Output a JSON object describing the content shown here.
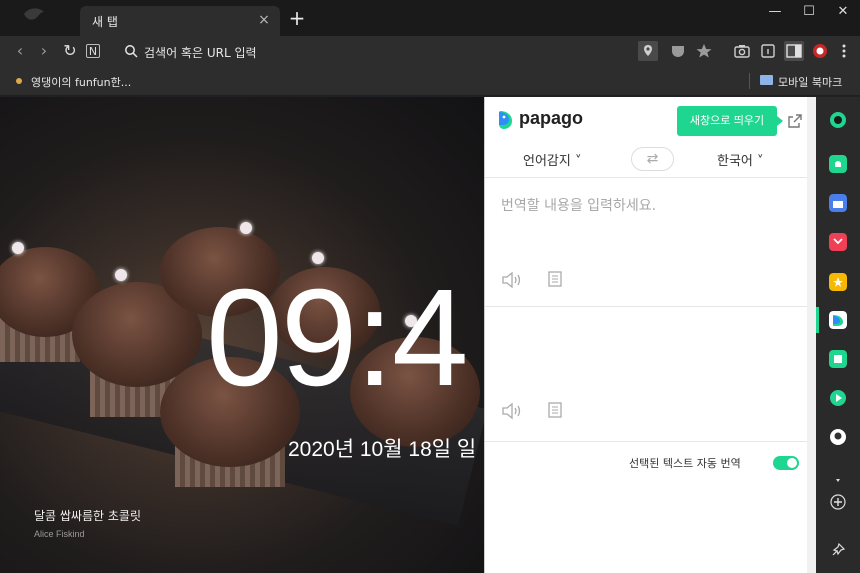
{
  "tab": {
    "title": "새 탭",
    "close": "×"
  },
  "newtab": "+",
  "window_controls": {
    "minimize": "—",
    "maximize": "☐",
    "close": "✕"
  },
  "toolbar": {
    "back": "‹",
    "forward": "›",
    "reload": "↻",
    "home": "N",
    "url_placeholder": "검색어 혹은 URL 입력"
  },
  "bookmarks": {
    "item": "영댕이의 funfun한...",
    "mobile": "모바일 북마크"
  },
  "newtab_page": {
    "clock": "09:4",
    "date": "2020년 10월 18일 일",
    "photo_title": "달콤 쌉싸름한 초콜릿",
    "photo_credit": "Alice Fiskind"
  },
  "papago": {
    "name": "papago",
    "popout_label": "새창으로 띄우기",
    "source_lang": "언어감지 ˅",
    "target_lang": "한국어 ˅",
    "swap": "⇄",
    "input_placeholder": "번역할 내용을 입력하세요.",
    "auto_translate_label": "선택된 텍스트 자동 번역",
    "auto_translate_on": true
  },
  "colors": {
    "papago_green": "#1ed690",
    "tab_bg": "#2d2d2d",
    "sidebar_bg": "#2a2a2a"
  },
  "sidebar_icons": [
    "whale-icon",
    "alarm-icon",
    "briefcase-icon",
    "pocket-icon",
    "star-icon",
    "papago-icon",
    "note-icon",
    "play-icon",
    "github-icon",
    "chevron-down-icon",
    "add-icon",
    "pin-icon"
  ]
}
